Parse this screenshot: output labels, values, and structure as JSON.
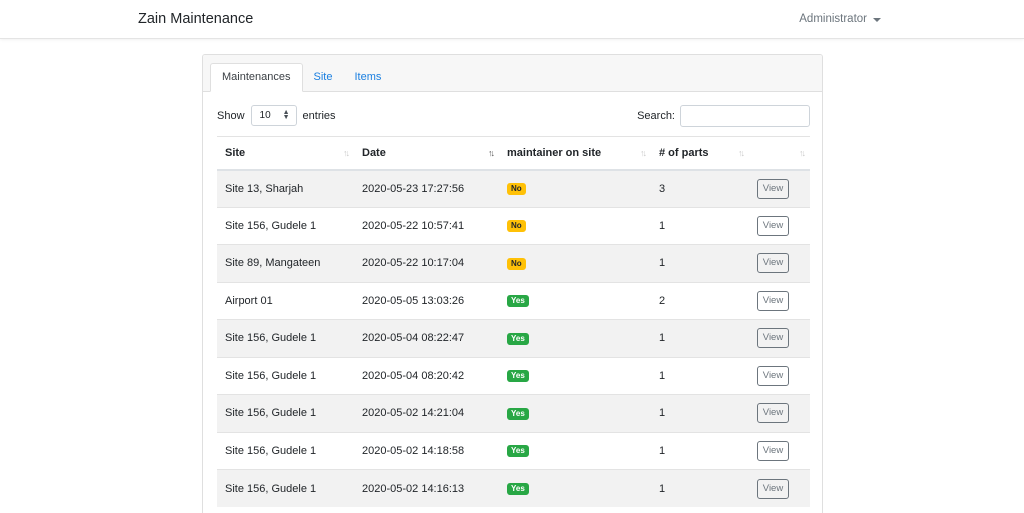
{
  "navbar": {
    "brand": "Zain Maintenance",
    "user": "Administrator"
  },
  "tabs": [
    {
      "label": "Maintenances",
      "active": true
    },
    {
      "label": "Site",
      "active": false
    },
    {
      "label": "Items",
      "active": false
    }
  ],
  "length_control": {
    "prefix": "Show",
    "value": "10",
    "suffix": "entries"
  },
  "search": {
    "label": "Search:",
    "value": "",
    "placeholder": ""
  },
  "table": {
    "columns": [
      "Site",
      "Date",
      "maintainer on site",
      "# of parts",
      ""
    ],
    "sorted_column": "Date",
    "sort_direction": "descending",
    "rows": [
      {
        "site": "Site 13, Sharjah",
        "date": "2020-05-23 17:27:56",
        "maintainer": "No",
        "parts": "3",
        "action": "View"
      },
      {
        "site": "Site 156, Gudele 1",
        "date": "2020-05-22 10:57:41",
        "maintainer": "No",
        "parts": "1",
        "action": "View"
      },
      {
        "site": "Site 89, Mangateen",
        "date": "2020-05-22 10:17:04",
        "maintainer": "No",
        "parts": "1",
        "action": "View"
      },
      {
        "site": "Airport 01",
        "date": "2020-05-05 13:03:26",
        "maintainer": "Yes",
        "parts": "2",
        "action": "View"
      },
      {
        "site": "Site 156, Gudele 1",
        "date": "2020-05-04 08:22:47",
        "maintainer": "Yes",
        "parts": "1",
        "action": "View"
      },
      {
        "site": "Site 156, Gudele 1",
        "date": "2020-05-04 08:20:42",
        "maintainer": "Yes",
        "parts": "1",
        "action": "View"
      },
      {
        "site": "Site 156, Gudele 1",
        "date": "2020-05-02 14:21:04",
        "maintainer": "Yes",
        "parts": "1",
        "action": "View"
      },
      {
        "site": "Site 156, Gudele 1",
        "date": "2020-05-02 14:18:58",
        "maintainer": "Yes",
        "parts": "1",
        "action": "View"
      },
      {
        "site": "Site 156, Gudele 1",
        "date": "2020-05-02 14:16:13",
        "maintainer": "Yes",
        "parts": "1",
        "action": "View"
      }
    ]
  },
  "colors": {
    "link": "#1a7fe0",
    "badge_no": "#ffc107",
    "badge_yes": "#28a745",
    "stripe": "#f2f2f2"
  },
  "icons": {
    "user_menu": "caret-down-icon",
    "sort": "sort-arrows-icon",
    "select": "select-arrows-icon"
  }
}
